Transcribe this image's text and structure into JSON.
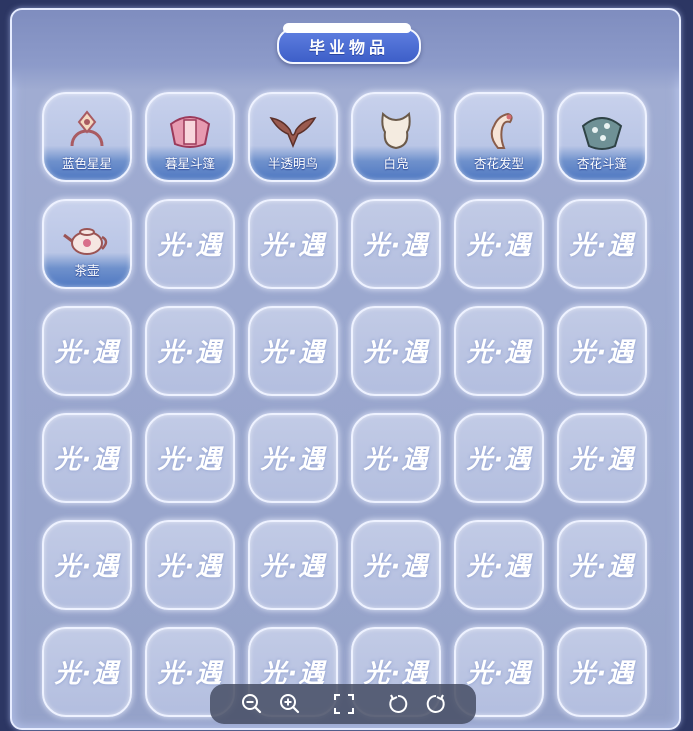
{
  "panel": {
    "title": "毕业物品"
  },
  "items": [
    {
      "label": "蓝色星星",
      "icon": "star-necklace-icon",
      "accent": "#b0636c"
    },
    {
      "label": "暮星斗篷",
      "icon": "pink-cape-icon",
      "accent": "#d56b8a"
    },
    {
      "label": "半透明鸟",
      "icon": "translucent-bird-icon",
      "accent": "#8a4f45"
    },
    {
      "label": "白凫",
      "icon": "white-hood-icon",
      "accent": "#f3e7da"
    },
    {
      "label": "杏花发型",
      "icon": "apricot-hairstyle-icon",
      "accent": "#f4dccc"
    },
    {
      "label": "杏花斗篷",
      "icon": "apricot-cape-icon",
      "accent": "#4d6f73"
    },
    {
      "label": "茶壶",
      "icon": "teapot-icon",
      "accent": "#f2e2df"
    }
  ],
  "empty_slot_text": "光·遇",
  "empty_slot_count": 29,
  "toolbar": {
    "buttons": [
      {
        "name": "zoom-out",
        "icon": "zoom-out-icon"
      },
      {
        "name": "zoom-in",
        "icon": "zoom-in-icon"
      },
      {
        "name": "fullscreen",
        "icon": "fullscreen-icon"
      },
      {
        "name": "rotate-left",
        "icon": "rotate-left-icon"
      },
      {
        "name": "rotate-right",
        "icon": "rotate-right-icon"
      }
    ]
  },
  "colors": {
    "background": "#2c3663",
    "panel": "#9ba8cf",
    "title_pill": "#4a6ad4",
    "label_band": "#4f78c2"
  }
}
